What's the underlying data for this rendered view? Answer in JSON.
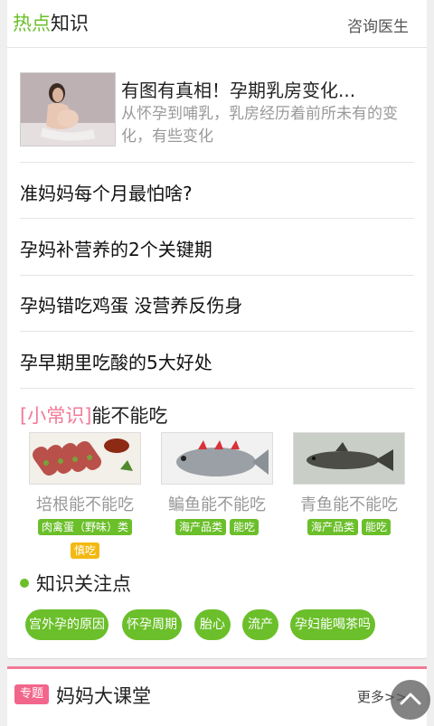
{
  "header": {
    "title_highlight": "热点",
    "title_rest": "知识",
    "consult_label": "咨询医生"
  },
  "feature": {
    "title": "有图有真相！孕期乳房变化...",
    "desc": "从怀孕到哺乳，乳房经历着前所未有的变化，有些变化"
  },
  "articles": [
    "准妈妈每个月最怕啥?",
    "孕妈补营养的2个关键期",
    "孕妈错吃鸡蛋 没营养反伤身",
    "孕早期里吃酸的5大好处"
  ],
  "tips": {
    "bracket_label": "[小常识]",
    "title": "能不能吃",
    "foods": [
      {
        "name": "培根能不能吃",
        "tags": [
          "肉禽蛋（野味）类",
          "慎吃"
        ]
      },
      {
        "name": "鳊鱼能不能吃",
        "tags": [
          "海产品类",
          "能吃"
        ]
      },
      {
        "name": "青鱼能不能吃",
        "tags": [
          "海产品类",
          "能吃"
        ]
      }
    ]
  },
  "focus": {
    "title": "知识关注点",
    "chips": [
      "宫外孕的原因",
      "怀孕周期",
      "胎心",
      "流产",
      "孕妇能喝茶吗"
    ]
  },
  "bottom": {
    "badge": "专题",
    "title": "妈妈大课堂",
    "more": "更多>>"
  },
  "colors": {
    "accent_green": "#6bbf2a",
    "accent_pink": "#f27a97",
    "warning_yellow": "#f3b913"
  }
}
